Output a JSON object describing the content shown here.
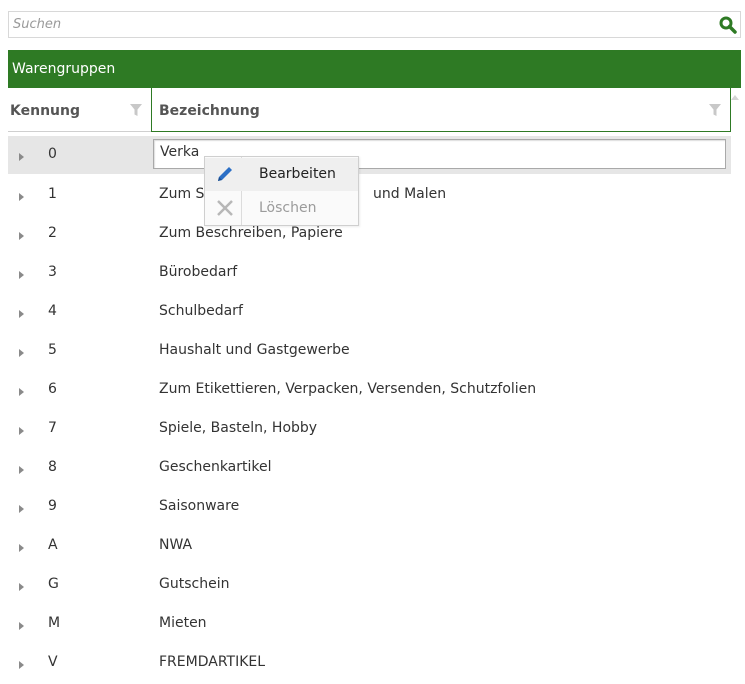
{
  "search": {
    "placeholder": "Suchen",
    "value": ""
  },
  "panel": {
    "title": "Warengruppen"
  },
  "columns": {
    "code": "Kennung",
    "name": "Bezeichnung"
  },
  "rows": [
    {
      "code": "0",
      "name": "Verkaufshilfe",
      "visible_name": "Verka"
    },
    {
      "code": "1",
      "name": "Zum Schreiben, Zeichnen und Malen",
      "visible_name_start": "Zum S",
      "visible_name_end": "und Malen"
    },
    {
      "code": "2",
      "name": "Zum Beschreiben, Papiere"
    },
    {
      "code": "3",
      "name": "Bürobedarf"
    },
    {
      "code": "4",
      "name": "Schulbedarf"
    },
    {
      "code": "5",
      "name": "Haushalt und Gastgewerbe"
    },
    {
      "code": "6",
      "name": "Zum Etikettieren, Verpacken, Versenden, Schutzfolien"
    },
    {
      "code": "7",
      "name": "Spiele, Basteln, Hobby"
    },
    {
      "code": "8",
      "name": "Geschenkartikel"
    },
    {
      "code": "9",
      "name": "Saisonware"
    },
    {
      "code": "A",
      "name": "NWA"
    },
    {
      "code": "G",
      "name": "Gutschein"
    },
    {
      "code": "M",
      "name": "Mieten"
    },
    {
      "code": "V",
      "name": "FREMDARTIKEL"
    }
  ],
  "context_menu": {
    "edit_label": "Bearbeiten",
    "delete_label": "Löschen",
    "edit_icon": "pencil-icon",
    "delete_icon": "x-icon"
  },
  "colors": {
    "header_green": "#2e7a24",
    "search_icon": "#2e7a24"
  }
}
